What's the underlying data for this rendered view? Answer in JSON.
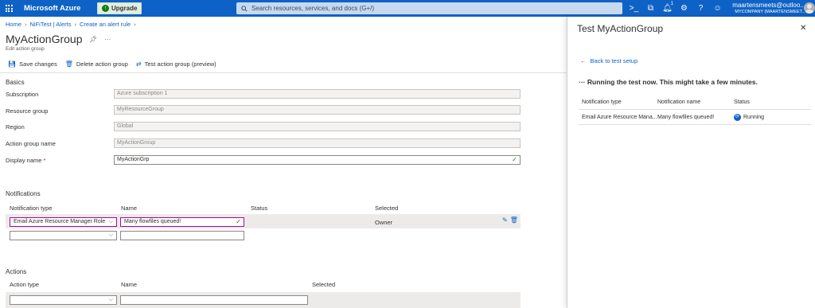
{
  "topbar": {
    "brand": "Microsoft Azure",
    "upgrade_label": "Upgrade",
    "search_placeholder": "Search resources, services, and docs (G+/)",
    "notification_count": "1",
    "account_name": "maartensmeets@outloo...",
    "account_directory": "MYCOMPANY (MAARTENSMEET...",
    "colors": {
      "bar": "#0f62c5",
      "upgrade_bg": "#e1efe1",
      "search_bg": "#c6d9f0"
    }
  },
  "breadcrumb": [
    "Home",
    "NiFiTest | Alerts",
    "Create an alert rule"
  ],
  "page": {
    "title": "MyActionGroup",
    "subtitle": "Edit action group"
  },
  "toolbar": {
    "save": "Save changes",
    "delete": "Delete action group",
    "test": "Test action group (preview)"
  },
  "basics": {
    "heading": "Basics",
    "fields": [
      {
        "label": "Subscription",
        "value": "Azure subscription 1"
      },
      {
        "label": "Resource group",
        "value": "MyResourceGroup"
      },
      {
        "label": "Region",
        "value": "Global"
      },
      {
        "label": "Action group name",
        "value": "MyActionGroup"
      },
      {
        "label": "Display name",
        "value": "MyActionGrp",
        "required": "*"
      }
    ]
  },
  "notifications": {
    "heading": "Notifications",
    "columns": [
      "Notification type",
      "Name",
      "Status",
      "Selected"
    ],
    "row": {
      "type": "Email Azure Resource Manager Role",
      "name": "Many flowfiles queued!",
      "selected": "Owner"
    }
  },
  "actions": {
    "heading": "Actions",
    "columns": [
      "Action type",
      "Name",
      "Selected"
    ]
  },
  "panel": {
    "title": "Test MyActionGroup",
    "back": "Back to test setup",
    "message": "Running the test now. This might take a few minutes.",
    "columns": [
      "Notification type",
      "Notification name",
      "Status"
    ],
    "row": {
      "type": "Email Azure Resource Mana...",
      "name": "Many flowfiles queued!",
      "status": "Running"
    }
  }
}
